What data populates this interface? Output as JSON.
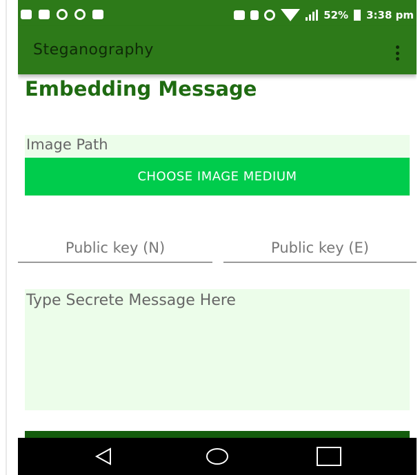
{
  "status_bar": {
    "battery": "52%",
    "time": "3:38 pm"
  },
  "app_bar": {
    "title": "Steganography"
  },
  "page": {
    "heading": "Embedding Message",
    "image_path_label": "Image Path",
    "choose_button_label": "CHOOSE IMAGE MEDIUM",
    "public_key_n_placeholder": "Public key (N)",
    "public_key_e_placeholder": "Public key (E)",
    "message_placeholder": "Type Secrete Message Here"
  },
  "colors": {
    "app_bar": "#2d7a19",
    "heading": "#1f6b12",
    "button": "#00cc4c",
    "field_background": "#ecfdea"
  },
  "icons": [
    "back-icon",
    "home-icon",
    "recent-apps-icon",
    "overflow-menu-icon"
  ]
}
